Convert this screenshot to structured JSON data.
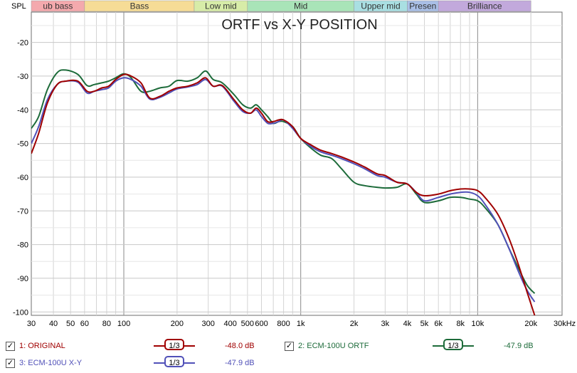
{
  "chart_data": {
    "type": "line",
    "title": "ORTF vs X-Y POSITION",
    "ylabel": "SPL",
    "xscale": "log",
    "xlim": [
      30,
      30000
    ],
    "ylim": [
      -101,
      -11
    ],
    "grid": true,
    "yticks": [
      -20,
      -30,
      -40,
      -50,
      -60,
      -70,
      -80,
      -90,
      -100
    ],
    "ytick_labels": [
      "-20",
      "-30",
      "-40",
      "-50",
      "-60",
      "-70",
      "-80",
      "-90",
      "-100"
    ],
    "xticks": [
      30,
      40,
      50,
      60,
      80,
      100,
      200,
      300,
      400,
      500,
      600,
      800,
      1000,
      2000,
      3000,
      4000,
      5000,
      6000,
      8000,
      10000,
      20000,
      30000
    ],
    "xtick_labels": [
      "30",
      "40",
      "50",
      "60",
      "80",
      "100",
      "200",
      "300",
      "400",
      "500",
      "600",
      "800",
      "1k",
      "2k",
      "3k",
      "4k",
      "5k",
      "6k",
      "8k",
      "10k",
      "20k",
      "30kHz"
    ],
    "bands": [
      {
        "label": "ub bass",
        "from": 20,
        "to": 60,
        "color": "#f4a9ad"
      },
      {
        "label": "Bass",
        "from": 60,
        "to": 250,
        "color": "#f6dc96"
      },
      {
        "label": "Low mid",
        "from": 250,
        "to": 500,
        "color": "#d7ecA8"
      },
      {
        "label": "Mid",
        "from": 500,
        "to": 2000,
        "color": "#a9e4b8"
      },
      {
        "label": "Upper mid",
        "from": 2000,
        "to": 4000,
        "color": "#a9dfe2"
      },
      {
        "label": "Presen",
        "from": 4000,
        "to": 6000,
        "color": "#a9bfe6"
      },
      {
        "label": "Brilliance",
        "from": 6000,
        "to": 20000,
        "color": "#c2a9dc"
      }
    ],
    "series": [
      {
        "name": "1: ORIGINAL",
        "color": "#a00000",
        "x": [
          30,
          33,
          37,
          42,
          47,
          55,
          62,
          68,
          75,
          82,
          90,
          100,
          110,
          125,
          140,
          160,
          180,
          200,
          230,
          260,
          290,
          320,
          360,
          420,
          470,
          520,
          560,
          600,
          650,
          700,
          750,
          800,
          900,
          1000,
          1150,
          1300,
          1500,
          1700,
          2000,
          2300,
          2700,
          3000,
          3500,
          4000,
          4500,
          5000,
          6000,
          7000,
          8000,
          9000,
          10000,
          11000,
          13000,
          15000,
          17000,
          19000,
          21000
        ],
        "y": [
          -53,
          -47,
          -38,
          -32.5,
          -31.5,
          -31.5,
          -34.5,
          -34.5,
          -33.5,
          -33,
          -31,
          -29.5,
          -30,
          -32,
          -36.5,
          -36,
          -34.5,
          -33.5,
          -33,
          -32,
          -30.5,
          -33,
          -32.8,
          -37,
          -40,
          -41,
          -39.5,
          -41,
          -43.5,
          -43.5,
          -43,
          -43,
          -45,
          -48.5,
          -50.5,
          -52,
          -53,
          -54,
          -55.5,
          -57,
          -59,
          -59.5,
          -61.5,
          -62,
          -64.5,
          -65.5,
          -65,
          -64,
          -63.5,
          -63.5,
          -64,
          -66,
          -71,
          -78,
          -86,
          -94,
          -101
        ]
      },
      {
        "name": "2: ECM-100U ORTF",
        "color": "#1d6b3a",
        "x": [
          30,
          33,
          37,
          42,
          47,
          55,
          62,
          68,
          75,
          82,
          90,
          100,
          110,
          125,
          140,
          160,
          180,
          200,
          230,
          260,
          290,
          320,
          360,
          420,
          470,
          520,
          560,
          600,
          650,
          700,
          750,
          800,
          900,
          1000,
          1150,
          1300,
          1500,
          1700,
          2000,
          2300,
          2700,
          3000,
          3500,
          4000,
          4500,
          5000,
          6000,
          7000,
          8000,
          9000,
          10000,
          11000,
          13000,
          15000,
          17000,
          19000,
          21000
        ],
        "y": [
          -45.5,
          -42,
          -34,
          -29,
          -28.2,
          -29.5,
          -32.8,
          -32.5,
          -32,
          -31.5,
          -30.5,
          -29.3,
          -30.5,
          -34.5,
          -34.5,
          -33.5,
          -33,
          -31.3,
          -31.5,
          -30.5,
          -28.5,
          -31,
          -32,
          -35.5,
          -38.5,
          -39.5,
          -38.5,
          -40,
          -42,
          -44,
          -43.5,
          -43.5,
          -45,
          -48.5,
          -51.5,
          -53.5,
          -54.5,
          -57.5,
          -61.5,
          -62.5,
          -63,
          -63.2,
          -63,
          -62,
          -65,
          -67.5,
          -67,
          -66,
          -66,
          -66.5,
          -67,
          -69,
          -74,
          -81,
          -87,
          -92,
          -94.5
        ]
      },
      {
        "name": "3: ECM-100U X-Y",
        "color": "#5050b8",
        "x": [
          30,
          33,
          37,
          42,
          47,
          55,
          62,
          68,
          75,
          82,
          90,
          100,
          110,
          125,
          140,
          160,
          180,
          200,
          230,
          260,
          290,
          320,
          360,
          420,
          470,
          520,
          560,
          600,
          650,
          700,
          750,
          800,
          900,
          1000,
          1150,
          1300,
          1500,
          1700,
          2000,
          2300,
          2700,
          3000,
          3500,
          4000,
          4500,
          5000,
          6000,
          7000,
          8000,
          9000,
          10000,
          11000,
          13000,
          15000,
          17000,
          19000,
          21000
        ],
        "y": [
          -50,
          -45,
          -37,
          -32.5,
          -31.5,
          -31.8,
          -35,
          -34.5,
          -34,
          -33.5,
          -31.5,
          -30.5,
          -31,
          -33,
          -36.8,
          -36.3,
          -35,
          -33.8,
          -33.2,
          -32.5,
          -31,
          -33,
          -33,
          -37.5,
          -40.5,
          -41,
          -40,
          -42,
          -44,
          -44,
          -43.5,
          -43,
          -45.5,
          -48.5,
          -51,
          -52.5,
          -53.5,
          -54.5,
          -56,
          -57.5,
          -59.5,
          -60,
          -61.5,
          -62,
          -64.5,
          -67,
          -66,
          -65,
          -64.5,
          -64.5,
          -65.5,
          -68,
          -74,
          -81,
          -88,
          -93.5,
          -97
        ]
      }
    ]
  },
  "legend": {
    "items": [
      {
        "label": "1: ORIGINAL",
        "smoothing": "1/3",
        "value": "-48.0 dB",
        "color": "#a00000",
        "checked": "✓"
      },
      {
        "label": "2: ECM-100U ORTF",
        "smoothing": "1/3",
        "value": "-47.9 dB",
        "color": "#1d6b3a",
        "checked": "✓"
      },
      {
        "label": "3: ECM-100U X-Y",
        "smoothing": "1/3",
        "value": "-47.9 dB",
        "color": "#5050b8",
        "checked": "✓"
      }
    ]
  }
}
